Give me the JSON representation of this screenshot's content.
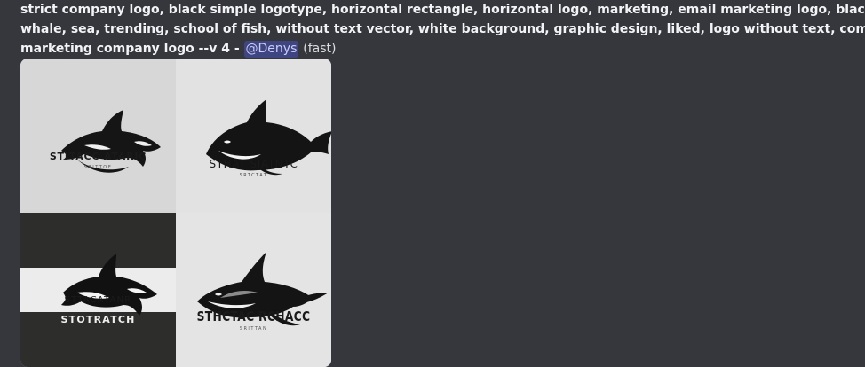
{
  "message": {
    "prompt_lines": [
      "strict company logo, black simple logotype, horizontal rectangle, horizontal logo, marketing, email marketing logo, black and white, killer",
      "whale, sea, trending, school of fish, without text vector, white background, graphic design, liked, logo without text, company logo,",
      "marketing company logo --v 4 - "
    ],
    "mention": "@Denys",
    "speed": "(fast)"
  },
  "images": [
    {
      "title": "STITACC ATARIC",
      "subtitle": "SRITTOE"
    },
    {
      "title": "STHAT SIATNTC",
      "subtitle": "SRTCTAT"
    },
    {
      "title": "STTACATANR",
      "subtitle": "STOTRATCH"
    },
    {
      "title": "STHCTAC RCHACC",
      "subtitle": "SRITTAN"
    }
  ]
}
